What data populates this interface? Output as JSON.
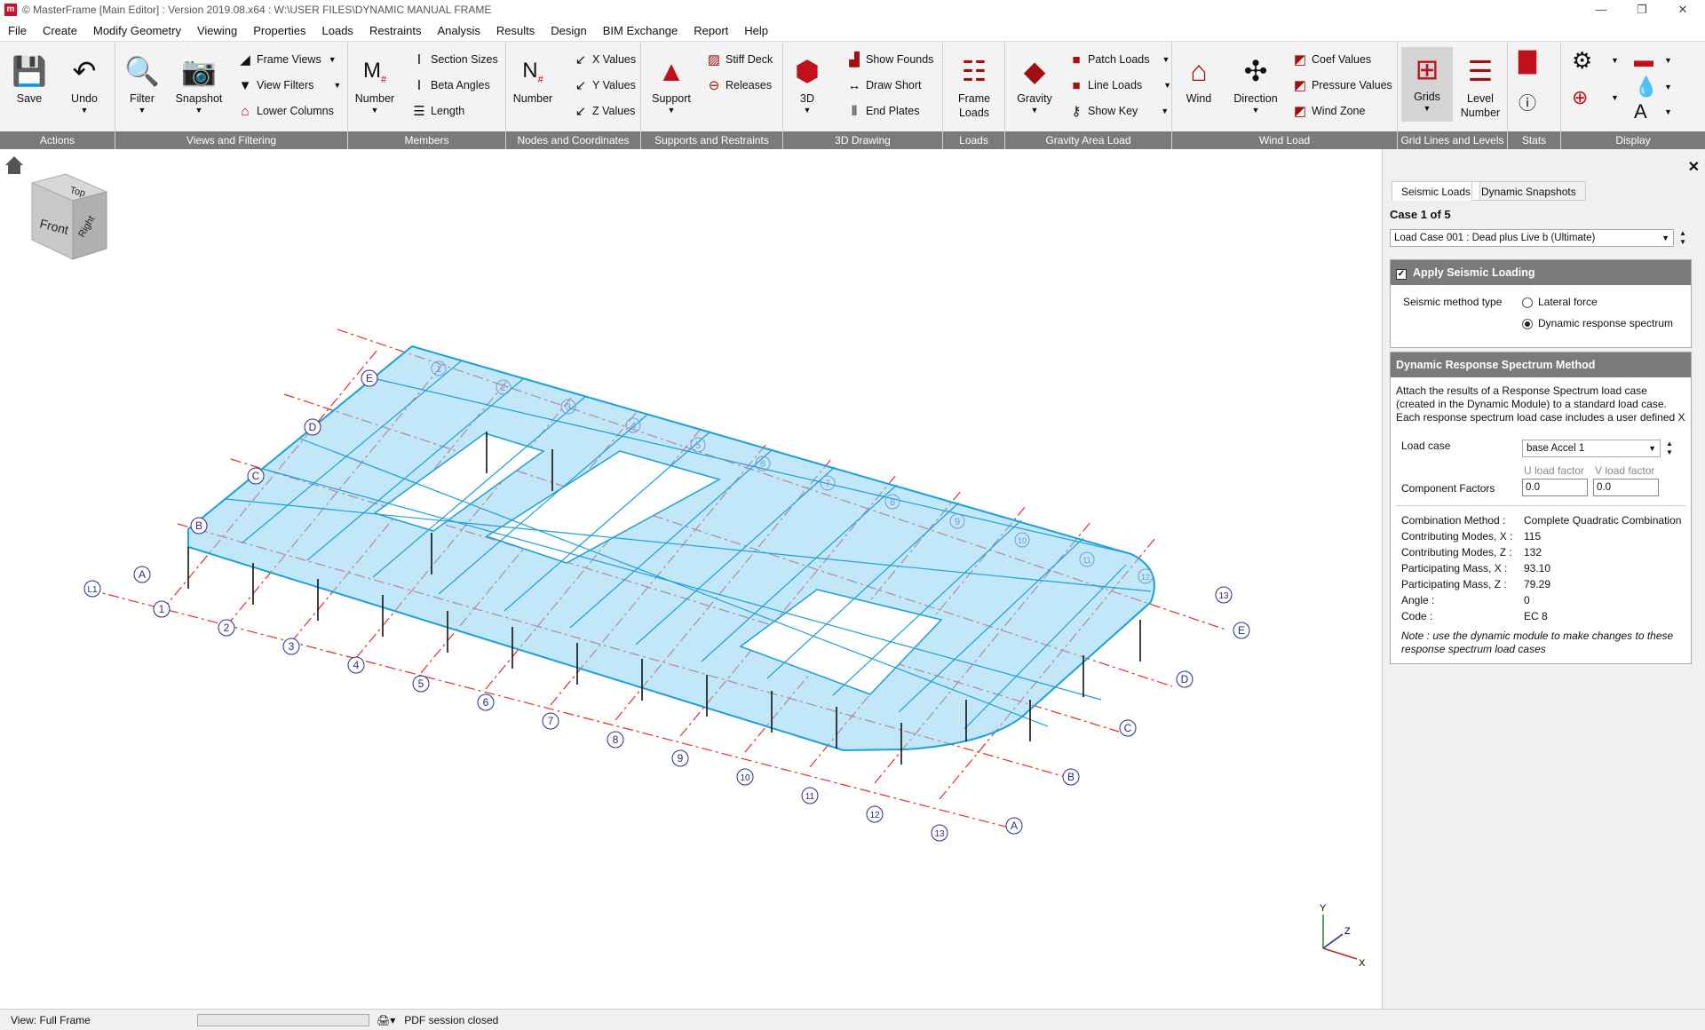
{
  "window": {
    "title": "© MasterFrame [Main Editor] : Version 2019.08.x64 : W:\\USER FILES\\DYNAMIC MANUAL FRAME",
    "app_icon_letter": "m",
    "minimize": "—",
    "restore": "❐",
    "close": "✕"
  },
  "menu": [
    "File",
    "Create",
    "Modify Geometry",
    "Viewing",
    "Properties",
    "Loads",
    "Restraints",
    "Analysis",
    "Results",
    "Design",
    "BIM Exchange",
    "Report",
    "Help"
  ],
  "ribbon": {
    "groups": {
      "actions": "Actions",
      "views": "Views and Filtering",
      "members": "Members",
      "nodes": "Nodes and Coordinates",
      "supports": "Supports and Restraints",
      "drawing3d": "3D Drawing",
      "loads": "Loads",
      "gravity": "Gravity Area Load",
      "wind": "Wind Load",
      "grids": "Grid Lines and Levels",
      "stats": "Stats",
      "display": "Display"
    },
    "buttons": {
      "save": "Save",
      "undo": "Undo",
      "filter": "Filter",
      "snapshot": "Snapshot",
      "frame_views": "Frame Views",
      "view_filters": "View Filters",
      "lower_columns": "Lower Columns",
      "member_number": "Number",
      "section_sizes": "Section Sizes",
      "beta_angles": "Beta Angles",
      "length": "Length",
      "node_number": "Number",
      "x_values": "X Values",
      "y_values": "Y Values",
      "z_values": "Z Values",
      "support": "Support",
      "stiff_deck": "Stiff Deck",
      "releases": "Releases",
      "three_d": "3D",
      "show_founds": "Show Founds",
      "draw_short": "Draw Short",
      "end_plates": "End Plates",
      "frame_loads_1": "Frame",
      "frame_loads_2": "Loads",
      "gravity": "Gravity",
      "patch_loads": "Patch Loads",
      "line_loads": "Line Loads",
      "show_key": "Show Key",
      "wind": "Wind",
      "direction": "Direction",
      "coef_values": "Coef Values",
      "pressure_values": "Pressure Values",
      "wind_zone": "Wind Zone",
      "grids": "Grids",
      "level_number_1": "Level",
      "level_number_2": "Number"
    }
  },
  "viewcube": {
    "top": "Top",
    "front": "Front",
    "right": "Right"
  },
  "axes": {
    "y": "Y",
    "z": "Z",
    "x": "X"
  },
  "grid_labels": {
    "numbers": [
      "1",
      "2",
      "3",
      "4",
      "5",
      "6",
      "7",
      "8",
      "9",
      "10",
      "11",
      "12",
      "13"
    ],
    "letters": [
      "A",
      "B",
      "C",
      "D",
      "E"
    ],
    "top_numbers": [
      "1",
      "2",
      "3",
      "4",
      "5",
      "6",
      "7",
      "8",
      "9",
      "10",
      "11",
      "12"
    ],
    "top_letters": [
      "E",
      "D",
      "C",
      "B"
    ],
    "left_end": "L1",
    "right_end": "13"
  },
  "panel": {
    "tabs": [
      "Seismic Loads",
      "Dynamic Snapshots"
    ],
    "case_label": "Case 1 of 5",
    "load_case_select": "Load Case 001 : Dead plus Live b (Ultimate)",
    "apply_seismic": "Apply Seismic Loading",
    "method_type_label": "Seismic method type",
    "method_options": [
      "Lateral force",
      "Dynamic response spectrum"
    ],
    "method_selected": "Dynamic response spectrum",
    "drs_header": "Dynamic Response Spectrum Method",
    "description": "Attach the results of a Response Spectrum load case (created in the Dynamic Module) to a standard load case. Each response spectrum load case includes a user defined X",
    "load_case_label": "Load case",
    "load_case_value": "base Accel 1",
    "u_factor_label": "U load factor",
    "v_factor_label": "V load factor",
    "component_factors_label": "Component Factors",
    "u_factor": "0.0",
    "v_factor": "0.0",
    "results": [
      {
        "label": "Combination Method :",
        "value": "Complete Quadratic Combination"
      },
      {
        "label": "Contributing Modes, X :",
        "value": "115"
      },
      {
        "label": "Contributing Modes, Z :",
        "value": "132"
      },
      {
        "label": "Participating Mass, X :",
        "value": "93.10"
      },
      {
        "label": "Participating Mass, Z :",
        "value": "79.29"
      },
      {
        "label": "Angle :",
        "value": "0"
      },
      {
        "label": "Code :",
        "value": "EC 8"
      }
    ],
    "note": "Note : use the dynamic module to make changes to these response spectrum load cases"
  },
  "status": {
    "view": "View: Full Frame",
    "pdf": "PDF session closed"
  },
  "colors": {
    "accent": "#1e9fd8",
    "panel_header": "#7a7a7a",
    "grid_line": "#e03030",
    "grid_bubble": "#2b2b8a",
    "slab_fill": "#8fd3f2"
  }
}
